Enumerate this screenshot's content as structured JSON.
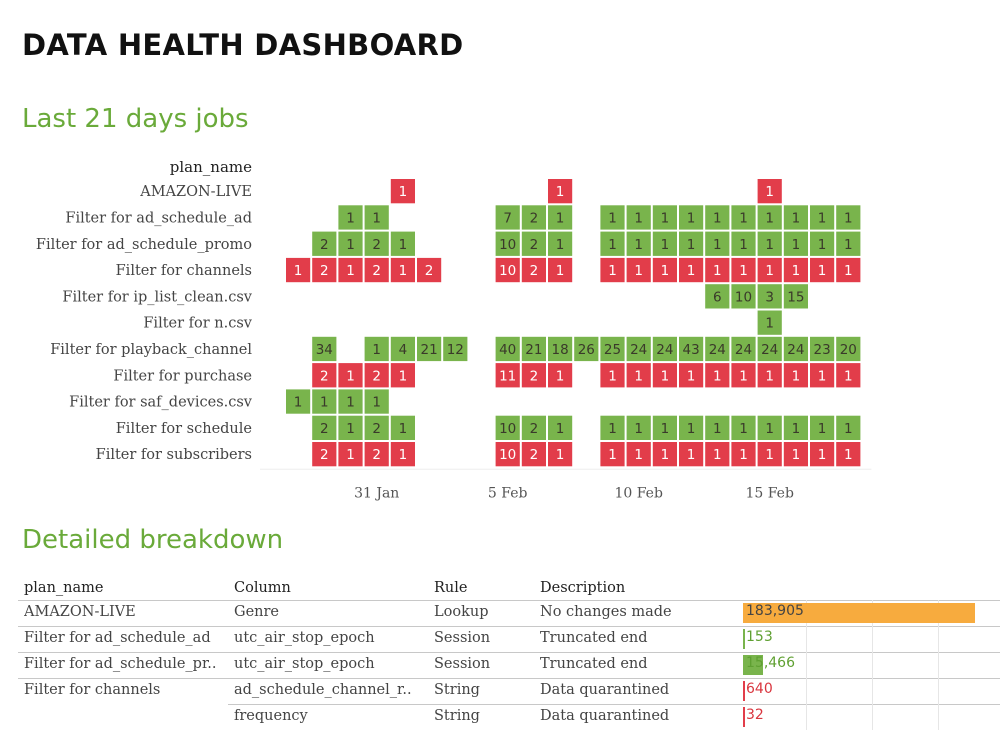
{
  "header": {
    "title": "DATA HEALTH DASHBOARD"
  },
  "sections": {
    "jobs_title": "Last 21 days jobs",
    "breakdown_title": "Detailed breakdown"
  },
  "colors": {
    "green": "#79b44c",
    "red": "#e23d4a",
    "orange": "#f7ab3e",
    "accent": "#6aaa3a"
  },
  "chart_data": {
    "type": "heatmap",
    "row_header": "plan_name",
    "x_ticks": [
      {
        "label": "31 Jan",
        "day": 3.5
      },
      {
        "label": "5 Feb",
        "day": 8.5
      },
      {
        "label": "10 Feb",
        "day": 13.5
      },
      {
        "label": "15 Feb",
        "day": 18.5
      }
    ],
    "rows": [
      {
        "name": "AMAZON-LIVE",
        "cells": [
          [
            4,
            "1",
            "red"
          ],
          [
            10,
            "1",
            "red"
          ],
          [
            18,
            "1",
            "red"
          ]
        ]
      },
      {
        "name": "Filter for ad_schedule_ad",
        "cells": [
          [
            2,
            "1",
            "green"
          ],
          [
            3,
            "1",
            "green"
          ],
          [
            8,
            "7",
            "green"
          ],
          [
            9,
            "2",
            "green"
          ],
          [
            10,
            "1",
            "green"
          ],
          [
            12,
            "1",
            "green"
          ],
          [
            13,
            "1",
            "green"
          ],
          [
            14,
            "1",
            "green"
          ],
          [
            15,
            "1",
            "green"
          ],
          [
            16,
            "1",
            "green"
          ],
          [
            17,
            "1",
            "green"
          ],
          [
            18,
            "1",
            "green"
          ],
          [
            19,
            "1",
            "green"
          ],
          [
            20,
            "1",
            "green"
          ],
          [
            21,
            "1",
            "green"
          ]
        ]
      },
      {
        "name": "Filter for ad_schedule_promo",
        "cells": [
          [
            1,
            "2",
            "green"
          ],
          [
            2,
            "1",
            "green"
          ],
          [
            3,
            "2",
            "green"
          ],
          [
            4,
            "1",
            "green"
          ],
          [
            8,
            "10",
            "green"
          ],
          [
            9,
            "2",
            "green"
          ],
          [
            10,
            "1",
            "green"
          ],
          [
            12,
            "1",
            "green"
          ],
          [
            13,
            "1",
            "green"
          ],
          [
            14,
            "1",
            "green"
          ],
          [
            15,
            "1",
            "green"
          ],
          [
            16,
            "1",
            "green"
          ],
          [
            17,
            "1",
            "green"
          ],
          [
            18,
            "1",
            "green"
          ],
          [
            19,
            "1",
            "green"
          ],
          [
            20,
            "1",
            "green"
          ],
          [
            21,
            "1",
            "green"
          ]
        ]
      },
      {
        "name": "Filter for channels",
        "cells": [
          [
            0,
            "1",
            "red"
          ],
          [
            1,
            "2",
            "red"
          ],
          [
            2,
            "1",
            "red"
          ],
          [
            3,
            "2",
            "red"
          ],
          [
            4,
            "1",
            "red"
          ],
          [
            5,
            "2",
            "red"
          ],
          [
            8,
            "10",
            "red"
          ],
          [
            9,
            "2",
            "red"
          ],
          [
            10,
            "1",
            "red"
          ],
          [
            12,
            "1",
            "red"
          ],
          [
            13,
            "1",
            "red"
          ],
          [
            14,
            "1",
            "red"
          ],
          [
            15,
            "1",
            "red"
          ],
          [
            16,
            "1",
            "red"
          ],
          [
            17,
            "1",
            "red"
          ],
          [
            18,
            "1",
            "red"
          ],
          [
            19,
            "1",
            "red"
          ],
          [
            20,
            "1",
            "red"
          ],
          [
            21,
            "1",
            "red"
          ]
        ]
      },
      {
        "name": "Filter for ip_list_clean.csv",
        "cells": [
          [
            16,
            "6",
            "green"
          ],
          [
            17,
            "10",
            "green"
          ],
          [
            18,
            "3",
            "green"
          ],
          [
            19,
            "15",
            "green"
          ]
        ]
      },
      {
        "name": "Filter for n.csv",
        "cells": [
          [
            18,
            "1",
            "green"
          ]
        ]
      },
      {
        "name": "Filter for playback_channel",
        "cells": [
          [
            1,
            "34",
            "green"
          ],
          [
            3,
            "1",
            "green"
          ],
          [
            4,
            "4",
            "green"
          ],
          [
            5,
            "21",
            "green"
          ],
          [
            6,
            "12",
            "green"
          ],
          [
            8,
            "40",
            "green"
          ],
          [
            9,
            "21",
            "green"
          ],
          [
            10,
            "18",
            "green"
          ],
          [
            11,
            "26",
            "green"
          ],
          [
            12,
            "25",
            "green"
          ],
          [
            13,
            "24",
            "green"
          ],
          [
            14,
            "24",
            "green"
          ],
          [
            15,
            "43",
            "green"
          ],
          [
            16,
            "24",
            "green"
          ],
          [
            17,
            "24",
            "green"
          ],
          [
            18,
            "24",
            "green"
          ],
          [
            19,
            "24",
            "green"
          ],
          [
            20,
            "23",
            "green"
          ],
          [
            21,
            "20",
            "green"
          ]
        ]
      },
      {
        "name": "Filter for purchase",
        "cells": [
          [
            1,
            "2",
            "red"
          ],
          [
            2,
            "1",
            "red"
          ],
          [
            3,
            "2",
            "red"
          ],
          [
            4,
            "1",
            "red"
          ],
          [
            8,
            "11",
            "red"
          ],
          [
            9,
            "2",
            "red"
          ],
          [
            10,
            "1",
            "red"
          ],
          [
            12,
            "1",
            "red"
          ],
          [
            13,
            "1",
            "red"
          ],
          [
            14,
            "1",
            "red"
          ],
          [
            15,
            "1",
            "red"
          ],
          [
            16,
            "1",
            "red"
          ],
          [
            17,
            "1",
            "red"
          ],
          [
            18,
            "1",
            "red"
          ],
          [
            19,
            "1",
            "red"
          ],
          [
            20,
            "1",
            "red"
          ],
          [
            21,
            "1",
            "red"
          ]
        ]
      },
      {
        "name": "Filter for saf_devices.csv",
        "cells": [
          [
            0,
            "1",
            "green"
          ],
          [
            1,
            "1",
            "green"
          ],
          [
            2,
            "1",
            "green"
          ],
          [
            3,
            "1",
            "green"
          ]
        ]
      },
      {
        "name": "Filter for schedule",
        "cells": [
          [
            1,
            "2",
            "green"
          ],
          [
            2,
            "1",
            "green"
          ],
          [
            3,
            "2",
            "green"
          ],
          [
            4,
            "1",
            "green"
          ],
          [
            8,
            "10",
            "green"
          ],
          [
            9,
            "2",
            "green"
          ],
          [
            10,
            "1",
            "green"
          ],
          [
            12,
            "1",
            "green"
          ],
          [
            13,
            "1",
            "green"
          ],
          [
            14,
            "1",
            "green"
          ],
          [
            15,
            "1",
            "green"
          ],
          [
            16,
            "1",
            "green"
          ],
          [
            17,
            "1",
            "green"
          ],
          [
            18,
            "1",
            "green"
          ],
          [
            19,
            "1",
            "green"
          ],
          [
            20,
            "1",
            "green"
          ],
          [
            21,
            "1",
            "green"
          ]
        ]
      },
      {
        "name": "Filter for subscribers",
        "cells": [
          [
            1,
            "2",
            "red"
          ],
          [
            2,
            "1",
            "red"
          ],
          [
            3,
            "2",
            "red"
          ],
          [
            4,
            "1",
            "red"
          ],
          [
            8,
            "10",
            "red"
          ],
          [
            9,
            "2",
            "red"
          ],
          [
            10,
            "1",
            "red"
          ],
          [
            12,
            "1",
            "red"
          ],
          [
            13,
            "1",
            "red"
          ],
          [
            14,
            "1",
            "red"
          ],
          [
            15,
            "1",
            "red"
          ],
          [
            16,
            "1",
            "red"
          ],
          [
            17,
            "1",
            "red"
          ],
          [
            18,
            "1",
            "red"
          ],
          [
            19,
            "1",
            "red"
          ],
          [
            20,
            "1",
            "red"
          ],
          [
            21,
            "1",
            "red"
          ]
        ]
      }
    ]
  },
  "breakdown": {
    "headers": {
      "plan_name": "plan_name",
      "column": "Column",
      "rule": "Rule",
      "description": "Description"
    },
    "max_value": 183905,
    "rows": [
      {
        "plan_name": "AMAZON-LIVE",
        "column": "Genre",
        "rule": "Lookup",
        "description": "No changes made",
        "value": 183905,
        "value_label": "183,905",
        "color": "orange"
      },
      {
        "plan_name": "Filter for ad_schedule_ad",
        "column": "utc_air_stop_epoch",
        "rule": "Session",
        "description": "Truncated end",
        "value": 153,
        "value_label": "153",
        "color": "green"
      },
      {
        "plan_name": "Filter for ad_schedule_pr..",
        "column": "utc_air_stop_epoch",
        "rule": "Session",
        "description": "Truncated end",
        "value": 15466,
        "value_label": "15,466",
        "color": "green"
      },
      {
        "plan_name": "Filter for channels",
        "column": "ad_schedule_channel_r..",
        "rule": "String",
        "description": "Data quarantined",
        "value": 640,
        "value_label": "640",
        "color": "red"
      },
      {
        "plan_name": "",
        "column": "frequency",
        "rule": "String",
        "description": "Data quarantined",
        "value": 32,
        "value_label": "32",
        "color": "red"
      }
    ]
  }
}
